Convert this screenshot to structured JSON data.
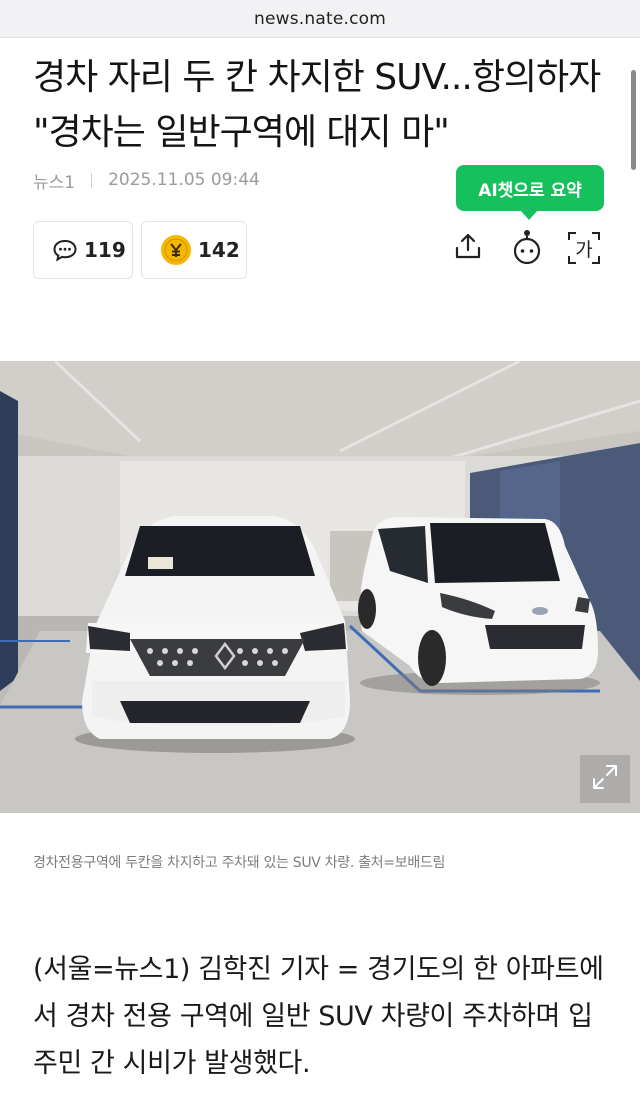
{
  "browser": {
    "url": "news.nate.com"
  },
  "article": {
    "headline": "경차 자리 두 칸 차지한 SUV...항의하자 \"경차는 일반구역에 대지 마\"",
    "source": "뉴스1",
    "datetime": "2025.11.05 09:44",
    "ai_summary_label": "AI챗으로 요약",
    "comment_count": "119",
    "coin_count": "142",
    "font_tool_label": "가",
    "photo_caption": "경차전용구역에 두칸을 차지하고 주차돼 있는 SUV 차량. 출처=보배드림",
    "body_paragraph": "(서울=뉴스1) 김학진 기자 = 경기도의 한 아파트에서 경차 전용 구역에 일반 SUV 차량이 주차하며 입주민 간 시비가 발생했다."
  },
  "icons": {
    "comments": "speech-bubble-icon",
    "coins": "coin-icon",
    "share": "share-icon",
    "bot": "chatbot-icon",
    "font": "font-size-icon",
    "expand": "expand-icon"
  },
  "colors": {
    "accent_green": "#15c05d",
    "coin_yellow": "#f5b800"
  }
}
